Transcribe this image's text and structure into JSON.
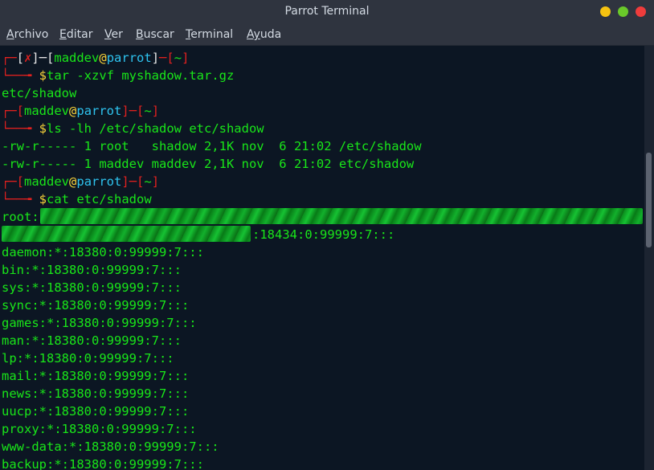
{
  "window": {
    "title": "Parrot Terminal"
  },
  "menu": [
    {
      "first": "A",
      "rest": "rchivo"
    },
    {
      "first": "E",
      "rest": "ditar"
    },
    {
      "first": "V",
      "rest": "er"
    },
    {
      "first": "B",
      "rest": "uscar"
    },
    {
      "first": "T",
      "rest": "erminal"
    },
    {
      "first": "Ay",
      "rest": "uda"
    }
  ],
  "prompt": {
    "corner_top": "┌─",
    "corner_bottom": "└──╼",
    "error_mark": "✗",
    "user": "maddev",
    "at": "@",
    "host": "parrot",
    "dir": "~",
    "dollar": "$"
  },
  "commands": [
    "tar -xzvf myshadow.tar.gz",
    "ls -lh /etc/shadow etc/shadow",
    "cat etc/shadow"
  ],
  "tar_output": "etc/shadow",
  "ls_output": [
    "-rw-r----- 1 root   shadow 2,1K nov  6 21:02 /etc/shadow",
    "-rw-r----- 1 maddev maddev 2,1K nov  6 21:02 etc/shadow"
  ],
  "shadow": {
    "root_prefix": "root:",
    "root_suffix": ":18434:0:99999:7:::",
    "entries": [
      "daemon:*:18380:0:99999:7:::",
      "bin:*:18380:0:99999:7:::",
      "sys:*:18380:0:99999:7:::",
      "sync:*:18380:0:99999:7:::",
      "games:*:18380:0:99999:7:::",
      "man:*:18380:0:99999:7:::",
      "lp:*:18380:0:99999:7:::",
      "mail:*:18380:0:99999:7:::",
      "news:*:18380:0:99999:7:::",
      "uucp:*:18380:0:99999:7:::",
      "proxy:*:18380:0:99999:7:::",
      "www-data:*:18380:0:99999:7:::",
      "backup:*:18380:0:99999:7:::"
    ]
  },
  "colors": {
    "background": "#0c1623",
    "output_green": "#19e619",
    "prompt_red": "#e3211f",
    "host_cyan": "#2ec4f0",
    "dollar_yellow": "#f7d23a"
  }
}
